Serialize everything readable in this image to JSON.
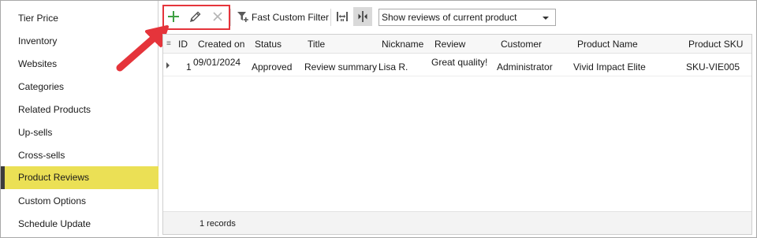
{
  "sidebar": {
    "items": [
      {
        "label": "Tier Price",
        "active": false
      },
      {
        "label": "Inventory",
        "active": false
      },
      {
        "label": "Websites",
        "active": false
      },
      {
        "label": "Categories",
        "active": false
      },
      {
        "label": "Related Products",
        "active": false
      },
      {
        "label": "Up-sells",
        "active": false
      },
      {
        "label": "Cross-sells",
        "active": false
      },
      {
        "label": "Product Reviews",
        "active": true
      },
      {
        "label": "Custom Options",
        "active": false
      },
      {
        "label": "Schedule Update",
        "active": false
      }
    ],
    "active_color": "#ebe055"
  },
  "toolbar": {
    "add_icon": "plus-icon",
    "edit_icon": "pencil-icon",
    "delete_icon": "close-icon",
    "filter_icon": "filter-add-icon",
    "filter_label": "Fast Custom Filter",
    "fit_columns_icon": "fit-columns-icon",
    "split_view_icon": "split-view-icon",
    "view_select": {
      "selected": "Show reviews of current product"
    },
    "highlight_color": "#e5343b"
  },
  "grid": {
    "columns": [
      "ID",
      "Created on",
      "Status",
      "Title",
      "Nickname",
      "Review",
      "Customer",
      "Product Name",
      "Product SKU"
    ],
    "rows": [
      {
        "id": "1",
        "created_on": "09/01/2024",
        "status": "Approved",
        "title": "Review summary",
        "nickname": "Lisa R.",
        "review": "Great quality!",
        "customer": "Administrator",
        "product_name": "Vivid Impact Elite",
        "product_sku": "SKU-VIE005"
      }
    ],
    "footer": "1 records"
  }
}
